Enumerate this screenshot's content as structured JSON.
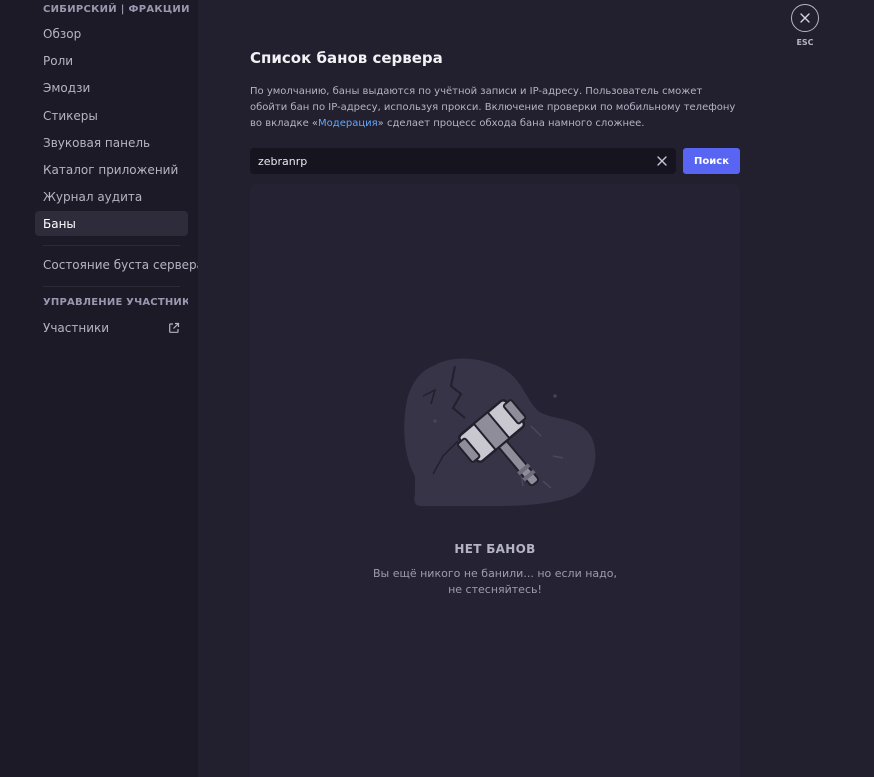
{
  "sidebar": {
    "header": "СИБИРСКИЙ | ФРАКЦИИ",
    "items": [
      {
        "label": "Обзор"
      },
      {
        "label": "Роли"
      },
      {
        "label": "Эмодзи"
      },
      {
        "label": "Стикеры"
      },
      {
        "label": "Звуковая панель"
      },
      {
        "label": "Каталог приложений"
      },
      {
        "label": "Журнал аудита"
      },
      {
        "label": "Баны",
        "active": true
      }
    ],
    "boost_item": "Состояние буста сервера",
    "section_title": "УПРАВЛЕНИЕ УЧАСТНИКА...",
    "members_item": "Участники"
  },
  "main": {
    "title": "Список банов сервера",
    "description_pre": "По умолчанию, баны выдаются по учётной записи и IP-адресу. Пользователь сможет обойти бан по IP-адресу, используя прокси. Включение проверки по мобильному телефону во вкладке «",
    "description_link": "Модерация",
    "description_post": "» сделает процесс обхода бана намного сложнее.",
    "search": {
      "value": "zebranrp",
      "button_label": "Поиск"
    },
    "empty": {
      "title": "НЕТ БАНОВ",
      "subtitle": "Вы ещё никого не банили... но если надо, не стесняйтесь!"
    }
  },
  "close": {
    "label": "ESC"
  },
  "colors": {
    "accent": "#5865f2",
    "link": "#5fa8ff"
  },
  "icons": {
    "close": "close-icon",
    "clear": "clear-icon",
    "external": "external-link-icon",
    "hammer": "ban-hammer-illustration"
  }
}
